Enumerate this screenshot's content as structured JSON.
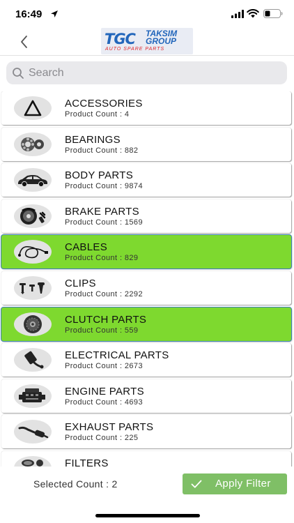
{
  "status_bar": {
    "time": "16:49",
    "icons": [
      "location-arrow-icon",
      "cellular-signal-icon",
      "wifi-icon",
      "battery-icon"
    ]
  },
  "header": {
    "back_icon": "chevron-left-icon",
    "logo": {
      "mark": "TGC",
      "name": "TAKSIM GROUP",
      "tagline": "AUTO SPARE PARTS"
    }
  },
  "search": {
    "placeholder": "Search",
    "value": ""
  },
  "categories": [
    {
      "name": "ACCESSORIES",
      "count": "Product Count : 4",
      "selected": false,
      "icon": "warning-triangle-icon"
    },
    {
      "name": "BEARINGS",
      "count": "Product Count : 882",
      "selected": false,
      "icon": "bearing-icon"
    },
    {
      "name": "BODY PARTS",
      "count": "Product Count : 9874",
      "selected": false,
      "icon": "car-body-icon"
    },
    {
      "name": "BRAKE PARTS",
      "count": "Product Count : 1569",
      "selected": false,
      "icon": "brake-disc-icon"
    },
    {
      "name": "CABLES",
      "count": "Product Count : 829",
      "selected": true,
      "icon": "cable-icon"
    },
    {
      "name": "CLIPS",
      "count": "Product Count : 2292",
      "selected": false,
      "icon": "clips-icon"
    },
    {
      "name": "CLUTCH PARTS",
      "count": "Product Count : 559",
      "selected": true,
      "icon": "clutch-plate-icon"
    },
    {
      "name": "ELECTRICAL PARTS",
      "count": "Product Count : 2673",
      "selected": false,
      "icon": "electrical-connector-icon"
    },
    {
      "name": "ENGINE PARTS",
      "count": "Product Count : 4693",
      "selected": false,
      "icon": "engine-icon"
    },
    {
      "name": "EXHAUST PARTS",
      "count": "Product Count : 225",
      "selected": false,
      "icon": "exhaust-pipe-icon"
    },
    {
      "name": "FILTERS",
      "count": "",
      "selected": false,
      "icon": "filter-icon"
    }
  ],
  "footer": {
    "selected_count": "Selected Count : 2",
    "apply_label": "Apply Filter",
    "apply_icon": "checkmark-icon"
  },
  "colors": {
    "selected_bg": "#7ed92f",
    "selected_border": "#3f7fb5",
    "apply_button": "#7fbf66",
    "logo_blue": "#2266bb",
    "logo_red": "#e0262a"
  }
}
